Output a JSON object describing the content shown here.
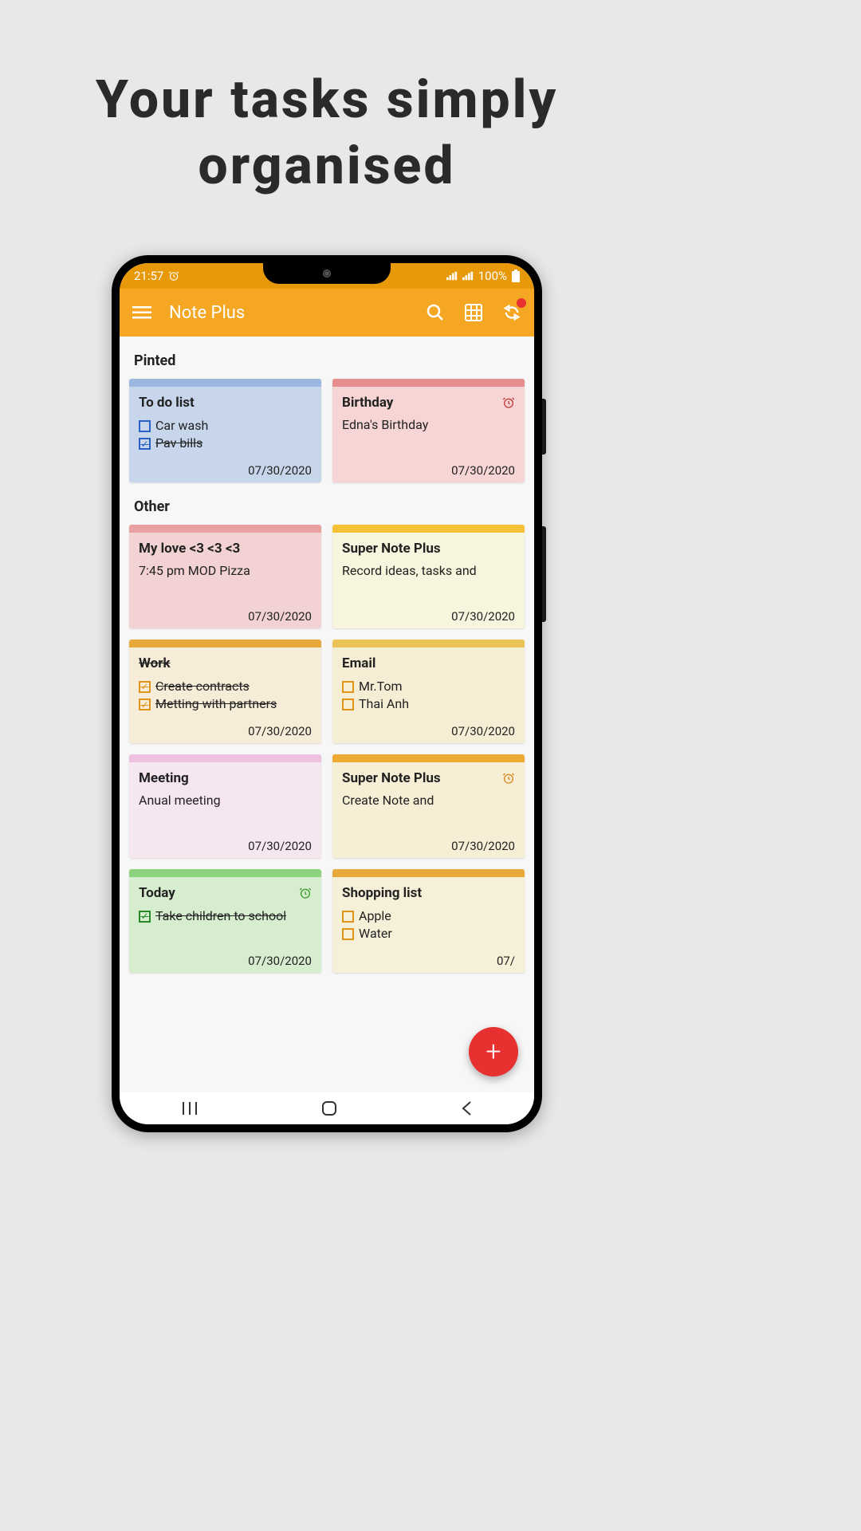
{
  "promo": {
    "line1": "Your tasks simply",
    "line2": "organised"
  },
  "status": {
    "time": "21:57",
    "battery": "100%"
  },
  "appbar": {
    "title": "Note Plus"
  },
  "sections": {
    "pinned_label": "Pinted",
    "other_label": "Other"
  },
  "cards": {
    "todo": {
      "title": "To do list",
      "item1": "Car wash",
      "item2": "Pav bills",
      "date": "07/30/2020"
    },
    "birthday": {
      "title": "Birthday",
      "body": "Edna's Birthday",
      "date": "07/30/2020"
    },
    "mylove": {
      "title": "My love <3 <3 <3",
      "body": "7:45 pm MOD Pizza",
      "date": "07/30/2020"
    },
    "supernote1": {
      "title": "Super Note Plus",
      "body": "Record ideas, tasks and",
      "date": "07/30/2020"
    },
    "work": {
      "title": "Work",
      "item1": "Create contracts",
      "item2": "Metting with partners",
      "date": "07/30/2020"
    },
    "email": {
      "title": "Email",
      "item1": "Mr.Tom",
      "item2": "Thai Anh",
      "date": "07/30/2020"
    },
    "meeting": {
      "title": "Meeting",
      "body": "Anual meeting",
      "date": "07/30/2020"
    },
    "supernote2": {
      "title": "Super Note Plus",
      "body": "Create Note and",
      "date": "07/30/2020"
    },
    "today": {
      "title": "Today",
      "item1": "Take children to school",
      "date": "07/30/2020"
    },
    "shopping": {
      "title": "Shopping list",
      "item1": "Apple",
      "item2": "Water",
      "date": "07/"
    }
  }
}
